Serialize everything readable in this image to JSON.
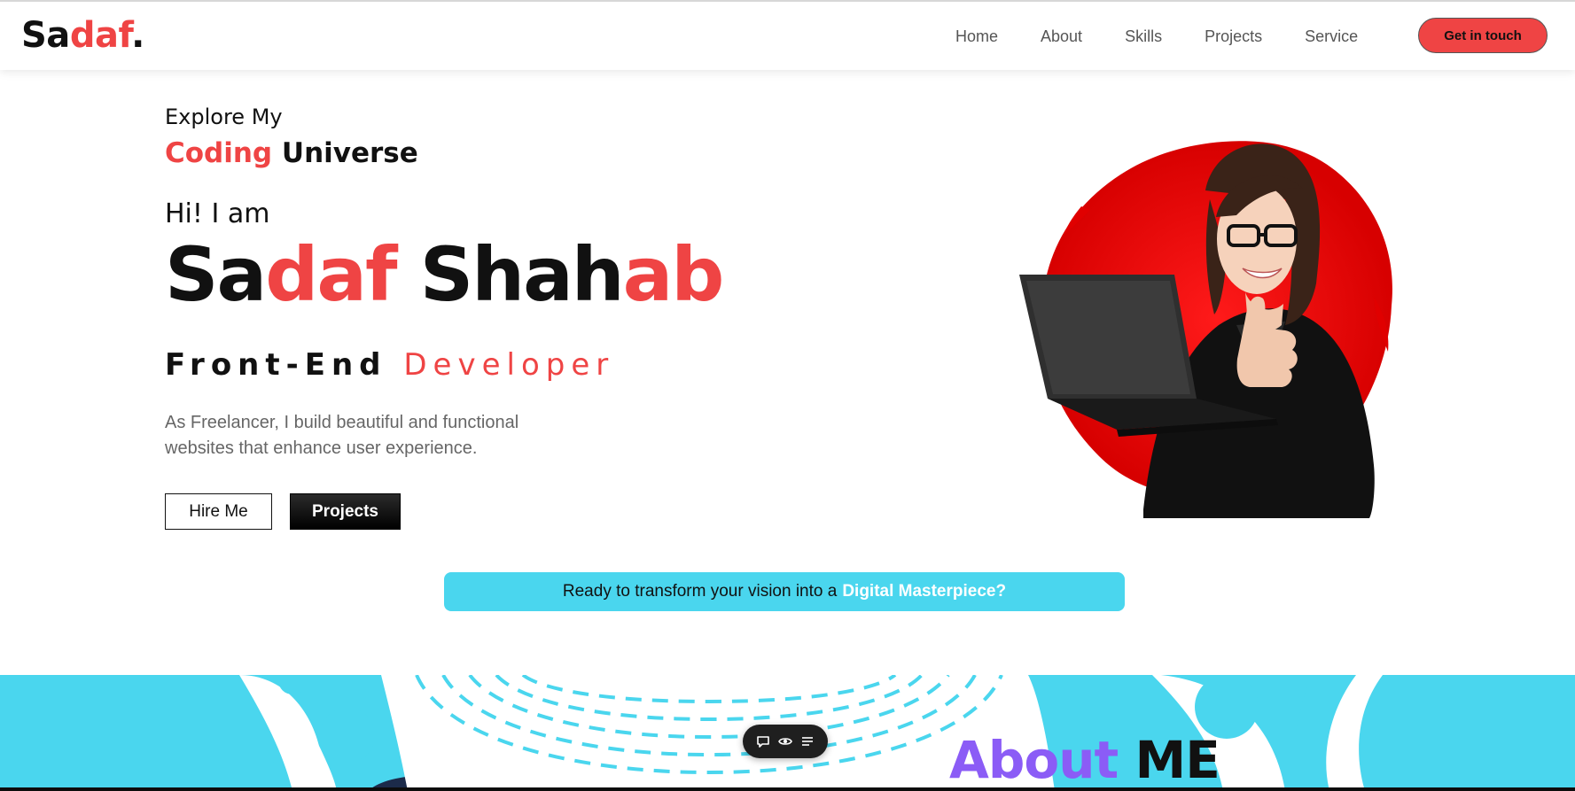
{
  "colors": {
    "accent": "#ef4444",
    "dark": "#111111",
    "cyan": "#4ad6ee",
    "purple": "#8b5cf6"
  },
  "logo": {
    "part1": "Sa",
    "part2": "daf",
    "part3": "."
  },
  "nav": {
    "items": [
      {
        "label": "Home"
      },
      {
        "label": "About"
      },
      {
        "label": "Skills"
      },
      {
        "label": "Projects"
      },
      {
        "label": "Service"
      }
    ],
    "cta_label": "Get in touch"
  },
  "hero": {
    "tagline_line1": "Explore My",
    "tagline_accent": "Coding",
    "tagline_dark": "Universe",
    "greeting": "Hi! I am",
    "name_parts": [
      "Sa",
      "daf",
      "Shah",
      "ab"
    ],
    "role_dark": "Front-End",
    "role_accent": "Developer",
    "intro": "As Freelancer, I build beautiful and functional websites that enhance user experience.",
    "buttons": {
      "hire_me": "Hire Me",
      "projects": "Projects"
    },
    "banner_text": "Ready to transform your vision into a",
    "banner_highlight": "Digital Masterpiece?"
  },
  "about": {
    "title_accent": "About",
    "title_dark": "ME"
  },
  "toolbar": {
    "icons": [
      "comment-icon",
      "eye-icon",
      "menu-icon"
    ]
  }
}
